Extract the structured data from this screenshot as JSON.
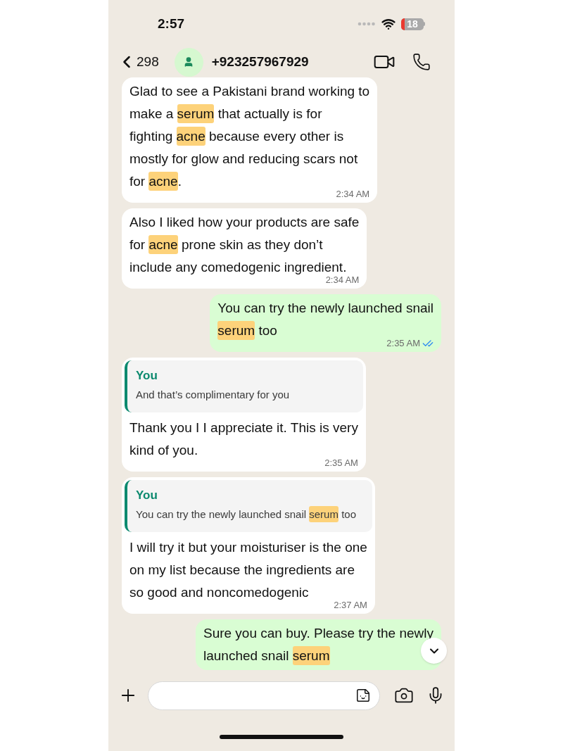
{
  "status_bar": {
    "time": "2:57",
    "battery": "18",
    "battery_low": true
  },
  "header": {
    "back_count": "298",
    "contact": "+923257967929"
  },
  "messages": [
    {
      "kind": "incoming",
      "lines": [
        [
          {
            "t": "Glad to see a Pakistani brand working to",
            "highlight": false
          }
        ],
        [
          {
            "t": "make a ",
            "highlight": false
          },
          {
            "t": "serum",
            "highlight": true
          },
          {
            "t": " that actually is for",
            "highlight": false
          }
        ],
        [
          {
            "t": "fighting ",
            "highlight": false
          },
          {
            "t": "acne",
            "highlight": true
          },
          {
            "t": " because every other is",
            "highlight": false
          }
        ],
        [
          {
            "t": "mostly for glow and reducing scars not",
            "highlight": false
          }
        ],
        [
          {
            "t": "for ",
            "highlight": false
          },
          {
            "t": "acne",
            "highlight": true
          },
          {
            "t": ".",
            "highlight": false
          }
        ]
      ],
      "time": "2:34 AM"
    },
    {
      "kind": "incoming",
      "lines": [
        [
          {
            "t": "Also I liked how your products are safe",
            "highlight": false
          }
        ],
        [
          {
            "t": "for ",
            "highlight": false
          },
          {
            "t": "acne",
            "highlight": true
          },
          {
            "t": " prone skin as they don’t",
            "highlight": false
          }
        ],
        [
          {
            "t": "include any comedogenic ingredient.",
            "highlight": false
          }
        ]
      ],
      "time": "2:34 AM"
    },
    {
      "kind": "outgoing",
      "read": true,
      "lines": [
        [
          {
            "t": "You can try the newly launched snail",
            "highlight": false
          }
        ],
        [
          {
            "t": "serum",
            "highlight": true
          },
          {
            "t": " too",
            "highlight": false
          }
        ]
      ],
      "time": "2:35 AM"
    },
    {
      "kind": "incoming",
      "quote": {
        "author": "You",
        "segments": [
          {
            "t": "And that’s complimentary for you",
            "highlight": false
          }
        ]
      },
      "lines": [
        [
          {
            "t": "Thank you I I appreciate it. This is very",
            "highlight": false
          }
        ],
        [
          {
            "t": "kind of you.",
            "highlight": false
          }
        ]
      ],
      "time": "2:35 AM"
    },
    {
      "kind": "incoming",
      "quote": {
        "author": "You",
        "segments": [
          {
            "t": "You can try the newly launched snail ",
            "highlight": false
          },
          {
            "t": "serum",
            "highlight": true
          },
          {
            "t": " too",
            "highlight": false
          }
        ]
      },
      "lines": [
        [
          {
            "t": "I will try it but your moisturiser is the one",
            "highlight": false
          }
        ],
        [
          {
            "t": "on my list because the ingredients are",
            "highlight": false
          }
        ],
        [
          {
            "t": "so good and noncomedogenic",
            "highlight": false
          }
        ]
      ],
      "time": "2:37 AM"
    },
    {
      "kind": "outgoing",
      "lines": [
        [
          {
            "t": "Sure you can buy. Please try the newly",
            "highlight": false
          }
        ],
        [
          {
            "t": "launched snail ",
            "highlight": false
          },
          {
            "t": "serum",
            "highlight": true
          }
        ]
      ]
    }
  ]
}
